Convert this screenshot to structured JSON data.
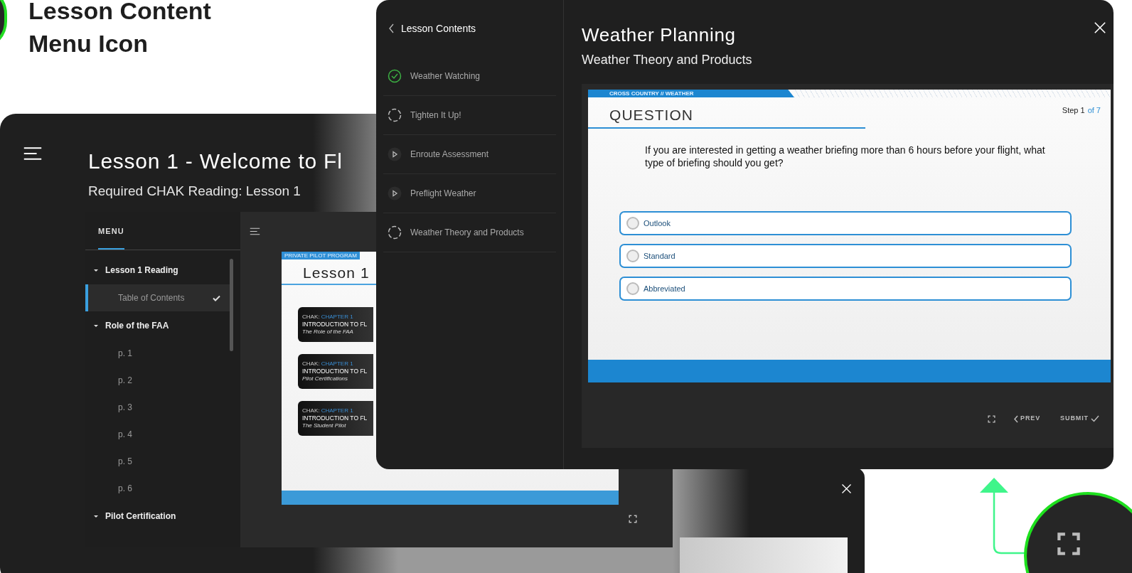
{
  "annotation": {
    "heading_lines": [
      "Lesson Content",
      "Menu Icon"
    ]
  },
  "lesson_window": {
    "title": "Lesson 1 - Welcome to Fl",
    "subtitle": "Required CHAK Reading: Lesson 1",
    "menu_tab": {
      "label": "MENU",
      "selected": true
    },
    "menu": [
      {
        "label": "Lesson 1 Reading",
        "expanded": true,
        "children": [
          {
            "label": "Table of Contents",
            "selected": true,
            "checked": true
          }
        ]
      },
      {
        "label": "Role of the FAA",
        "expanded": true,
        "children": [
          {
            "label": "p. 1",
            "selected": false,
            "checked": false
          },
          {
            "label": "p. 2",
            "selected": false,
            "checked": false
          },
          {
            "label": "p. 3",
            "selected": false,
            "checked": false
          },
          {
            "label": "p. 4",
            "selected": false,
            "checked": false
          },
          {
            "label": "p. 5",
            "selected": false,
            "checked": false
          },
          {
            "label": "p. 6",
            "selected": false,
            "checked": false
          }
        ]
      },
      {
        "label": "Pilot Certification",
        "expanded": true
      }
    ],
    "slide": {
      "banner": "PRIVATE PILOT PROGRAM",
      "title": "Lesson 1",
      "cards": [
        {
          "source": "CHAK:",
          "chapter": "CHAPTER 1",
          "title": "INTRODUCTION TO FL",
          "subtitle": "The Role of the FAA"
        },
        {
          "source": "CHAK:",
          "chapter": "CHAPTER 1",
          "title": "INTRODUCTION TO FL",
          "subtitle": "Pilot Certifications"
        },
        {
          "source": "CHAK:",
          "chapter": "CHAPTER 1",
          "title": "INTRODUCTION TO FL",
          "subtitle": "The Student Pilot"
        }
      ]
    }
  },
  "quiz_window": {
    "back_label": "Lesson Contents",
    "contents": [
      {
        "kind": "complete",
        "label": "Weather Watching"
      },
      {
        "kind": "pending",
        "label": "Tighten It Up!"
      },
      {
        "kind": "video",
        "label": "Enroute Assessment"
      },
      {
        "kind": "video",
        "label": "Preflight Weather"
      },
      {
        "kind": "pending",
        "label": "Weather Theory and Products"
      }
    ],
    "title": "Weather Planning",
    "subtitle": "Weather Theory and Products",
    "slide": {
      "banner": "CROSS COUNTRY // WEATHER",
      "heading": "QUESTION",
      "step": "Step 1",
      "step_total": "of 7",
      "question": "If you are interested in getting a weather briefing more than 6 hours before your flight, what type of briefing should you get?",
      "options": [
        {
          "label": "Outlook",
          "selected": false
        },
        {
          "label": "Standard",
          "selected": false
        },
        {
          "label": "Abbreviated",
          "selected": false
        }
      ]
    },
    "controls": {
      "prev": "PREV",
      "submit": "SUBMIT"
    }
  }
}
